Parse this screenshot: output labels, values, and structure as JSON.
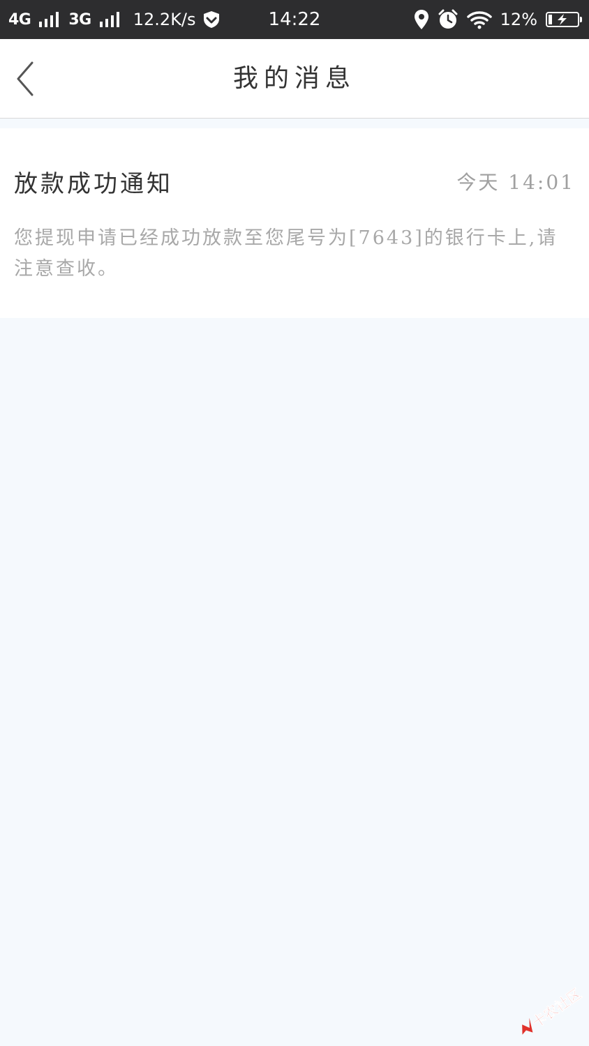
{
  "status_bar": {
    "network_1": "4G",
    "network_2": "3G",
    "speed": "12.2K/s",
    "time": "14:22",
    "battery_percent": "12%",
    "battery_level": 0.12,
    "icons": [
      "signal-icon",
      "shield-icon",
      "location-icon",
      "alarm-icon",
      "wifi-icon",
      "battery-charging-icon"
    ]
  },
  "header": {
    "title": "我的消息",
    "back_icon": "chevron-left-icon"
  },
  "messages": [
    {
      "title": "放款成功通知",
      "time": "今天 14:01",
      "body": "您提现申请已经成功放款至您尾号为[7643]的银行卡上,请注意查收。"
    }
  ],
  "watermark": {
    "text": "卡农社区"
  },
  "colors": {
    "status_bar": "#2d2d2f",
    "page_background": "#f5f9fd",
    "watermark_red": "#e0312b"
  }
}
